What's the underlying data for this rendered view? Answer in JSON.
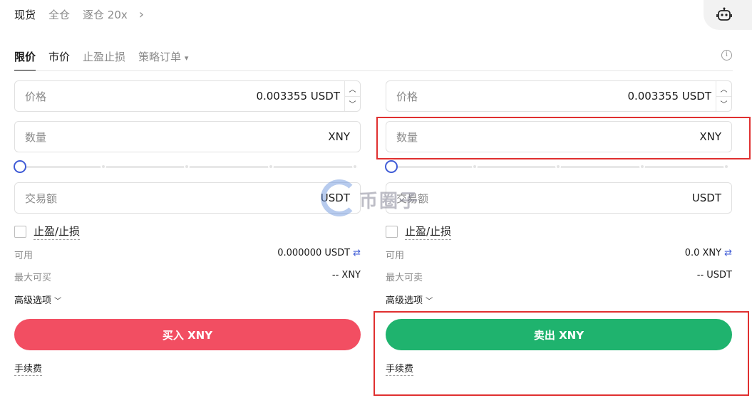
{
  "header": {
    "modes": [
      "现货",
      "全仓",
      "逐仓 20x"
    ],
    "active_mode": "现货",
    "chevron": "›"
  },
  "order_types": {
    "tabs": [
      "限价",
      "市价",
      "止盈止损",
      "策略订单"
    ],
    "active": "限价",
    "dropdown_caret": "▾",
    "info_glyph": "i"
  },
  "buy": {
    "price_label": "价格",
    "price_value": "0.003355 USDT",
    "amount_label": "数量",
    "amount_unit": "XNY",
    "slider_percent": 0,
    "total_label": "交易额",
    "total_unit": "USDT",
    "tpsl_label": "止盈/止损",
    "available_label": "可用",
    "available_value": "0.000000 USDT",
    "max_label": "最大可买",
    "max_value": "-- XNY",
    "advanced_label": "高级选项",
    "button_label": "买入 XNY",
    "fee_label": "手续费"
  },
  "sell": {
    "price_label": "价格",
    "price_value": "0.003355 USDT",
    "amount_label": "数量",
    "amount_unit": "XNY",
    "slider_percent": 0,
    "total_label": "交易额",
    "total_unit": "USDT",
    "tpsl_label": "止盈/止损",
    "available_label": "可用",
    "available_value": "0.0 XNY",
    "max_label": "最大可卖",
    "max_value": "-- USDT",
    "advanced_label": "高级选项",
    "button_label": "卖出 XNY",
    "fee_label": "手续费"
  },
  "watermark": {
    "text": "币圈子"
  },
  "colors": {
    "buy": "#f24e62",
    "sell": "#1fb36e",
    "accent": "#3f5bd6",
    "highlight": "#e03030"
  }
}
